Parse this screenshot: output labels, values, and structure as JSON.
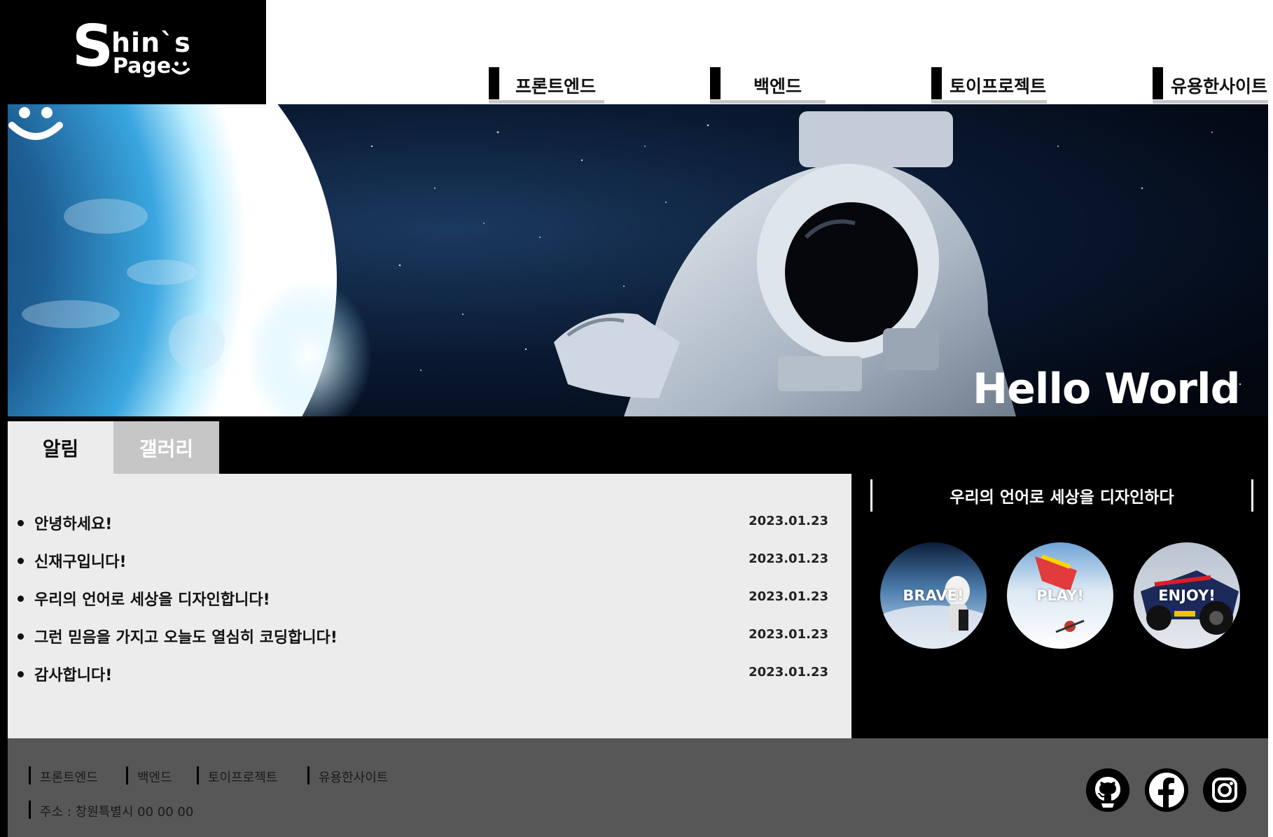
{
  "brand": {
    "logo_s": "S",
    "logo_line1": "hin`s",
    "logo_line2": "Page"
  },
  "nav": {
    "items": [
      {
        "label": "프론트엔드"
      },
      {
        "label": "백엔드"
      },
      {
        "label": "토이프로젝트"
      },
      {
        "label": "유용한사이트"
      }
    ]
  },
  "hero": {
    "title": "Hello World"
  },
  "tabs": [
    {
      "label": "알림",
      "active": true
    },
    {
      "label": "갤러리",
      "active": false
    }
  ],
  "notices": [
    {
      "title": "안녕하세요!",
      "date": "2023.01.23"
    },
    {
      "title": "신재구입니다!",
      "date": "2023.01.23"
    },
    {
      "title": "우리의 언어로 세상을 디자인합니다!",
      "date": "2023.01.23"
    },
    {
      "title": "그런 믿음을 가지고 오늘도 열심히 코딩합니다!",
      "date": "2023.01.23"
    },
    {
      "title": "감사합니다!",
      "date": "2023.01.23"
    }
  ],
  "side": {
    "tagline": "우리의 언어로 세상을 디자인하다",
    "circles": [
      {
        "label": "BRAVE!"
      },
      {
        "label": "PLAY!"
      },
      {
        "label": "ENJOY!"
      }
    ]
  },
  "footer": {
    "nav": [
      {
        "label": "프론트엔드"
      },
      {
        "label": "백엔드"
      },
      {
        "label": "토이프로젝트"
      },
      {
        "label": "유용한사이트"
      }
    ],
    "address": "주소 : 창원특별시 00 00 00",
    "social": [
      {
        "icon": "github-icon"
      },
      {
        "icon": "facebook-icon"
      },
      {
        "icon": "instagram-icon"
      }
    ]
  },
  "colors": {
    "nav_underline": "#c8c8c8",
    "notice_bg": "#ececec",
    "inactive_tab_bg": "#c6c6c6",
    "footer_bg": "#575757"
  }
}
